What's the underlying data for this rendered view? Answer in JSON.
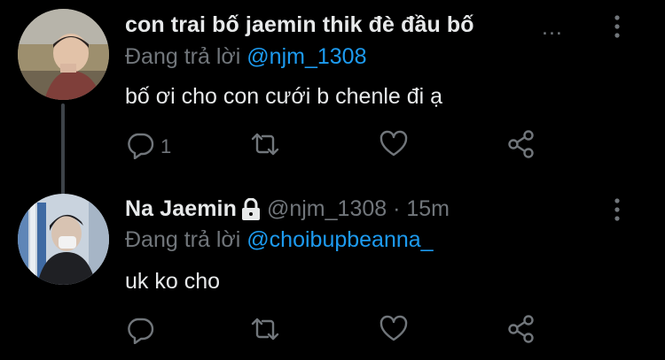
{
  "tweets": [
    {
      "display_name": "con trai bố jaemin thik đè đầu bố",
      "truncation": "...",
      "reply_prefix": "Đang trả lời",
      "reply_mention": "@njm_1308",
      "text": "bố ơi cho con cưới b chenle đi ạ",
      "reply_count": "1"
    },
    {
      "display_name": "Na Jaemin",
      "handle_meta": "@njm_1308 · 15m",
      "reply_prefix": "Đang trả lời",
      "reply_mention": "@choibupbeanna_",
      "text": "uk ko cho",
      "reply_count": ""
    }
  ],
  "colors": {
    "background": "#000000",
    "primary_text": "#e7e9ea",
    "secondary_text": "#71767b",
    "mention": "#1d9bf0",
    "thread_line": "#3d4349"
  },
  "icons": [
    "avatar",
    "lock-icon",
    "more-icon",
    "reply-icon",
    "retweet-icon",
    "like-icon",
    "share-icon"
  ]
}
